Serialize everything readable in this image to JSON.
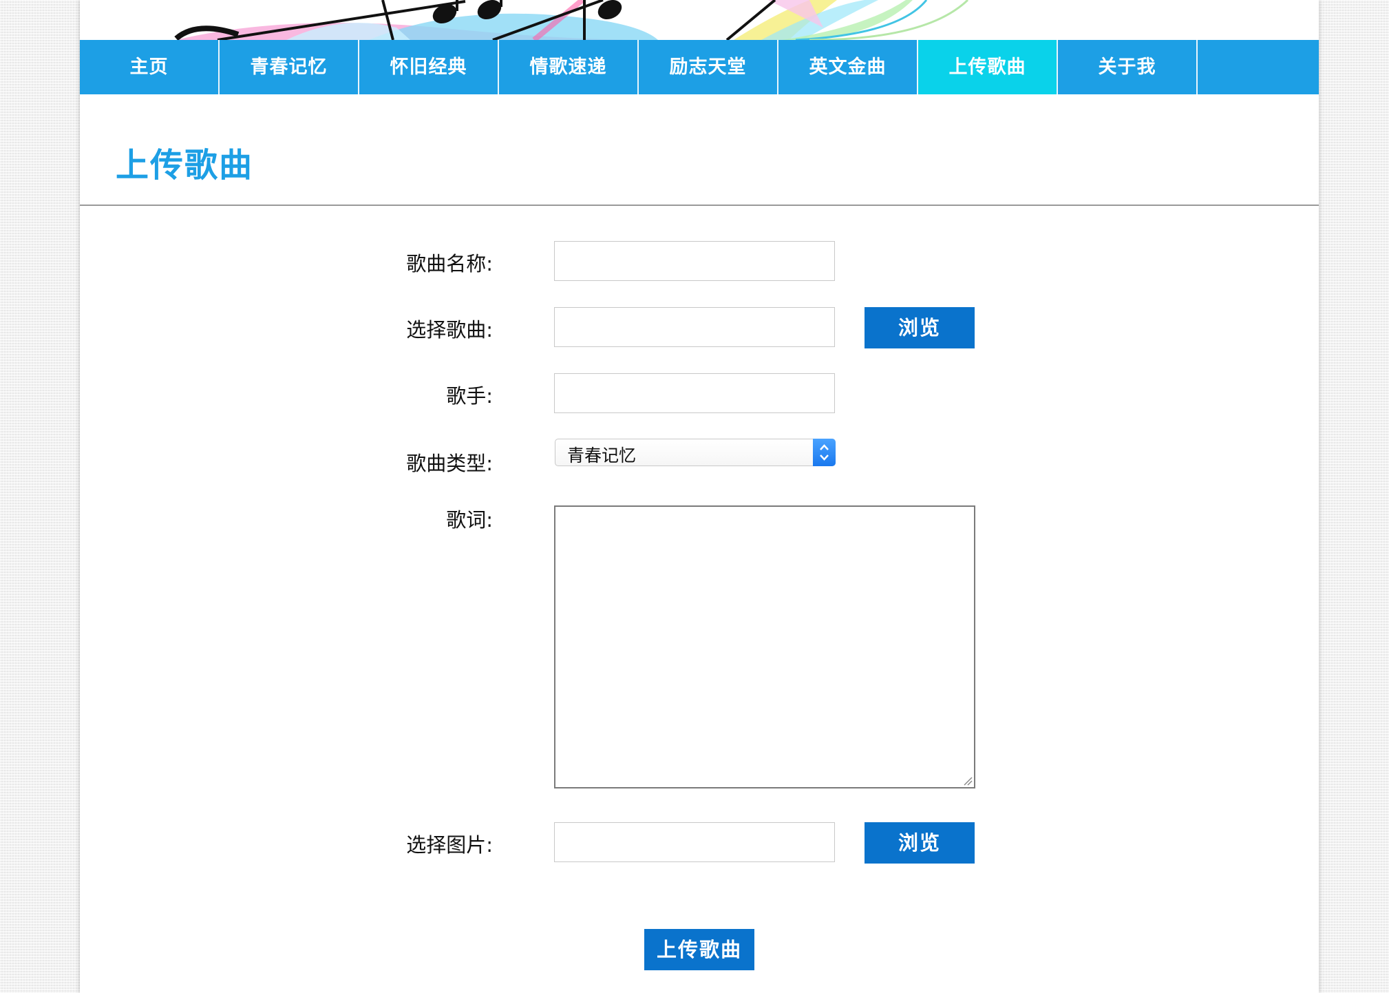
{
  "nav": {
    "items": [
      {
        "label": "主页"
      },
      {
        "label": "青春记忆"
      },
      {
        "label": "怀旧经典"
      },
      {
        "label": "情歌速递"
      },
      {
        "label": "励志天堂"
      },
      {
        "label": "英文金曲"
      },
      {
        "label": "上传歌曲"
      },
      {
        "label": "关于我"
      }
    ],
    "active_index": 6
  },
  "page": {
    "title": "上传歌曲"
  },
  "form": {
    "song_name_label": "歌曲名称:",
    "song_name_value": "",
    "choose_song_label": "选择歌曲:",
    "choose_song_value": "",
    "browse_label": "浏览",
    "singer_label": "歌手:",
    "singer_value": "",
    "type_label": "歌曲类型:",
    "type_selected": "青春记忆",
    "lyrics_label": "歌词:",
    "lyrics_value": "",
    "choose_image_label": "选择图片:",
    "choose_image_value": "",
    "browse_image_label": "浏览",
    "submit_label": "上传歌曲"
  },
  "colors": {
    "nav_bg": "#1d9fe5",
    "nav_active": "#0ad2ea",
    "title": "#1d9fe5",
    "button": "#0a73cc"
  }
}
